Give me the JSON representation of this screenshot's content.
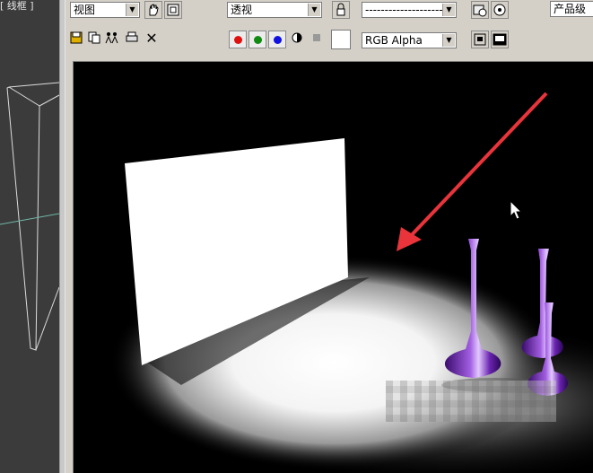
{
  "left_viewport": {
    "label": "[ 线框 ]"
  },
  "toolbar_row1": {
    "area_dropdown": "视图",
    "viewport_dropdown": "透视",
    "preset_dropdown": "---------------------",
    "quality_label": "产品级"
  },
  "toolbar_row2": {
    "channel_dropdown": "RGB Alpha",
    "color_channels": [
      {
        "name": "red",
        "color": "#e01010"
      },
      {
        "name": "green",
        "color": "#108a10"
      },
      {
        "name": "blue",
        "color": "#1010e0"
      }
    ],
    "swatch_color": "#ffffff"
  },
  "icons": [
    "save-icon",
    "copy-icon",
    "clone-icon",
    "print-icon",
    "clear-icon",
    "pan-icon",
    "region-icon",
    "lock-icon",
    "render-setup-icon",
    "render-icon",
    "mono-icon",
    "alpha-icon",
    "frame-icon",
    "display-icon"
  ]
}
